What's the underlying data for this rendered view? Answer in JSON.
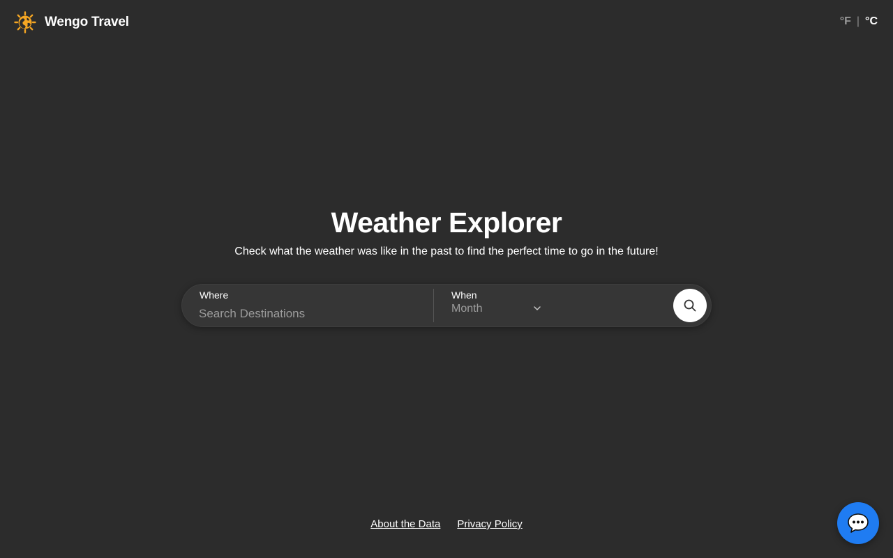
{
  "header": {
    "logo_icon": "sun-globe-logo-icon",
    "brand_name": "Wengo Travel",
    "units": {
      "fahrenheit_label": "°F",
      "separator": "|",
      "celsius_label": "°C",
      "selected": "°C"
    }
  },
  "hero": {
    "title": "Weather Explorer",
    "subtitle": "Check what the weather was like in the past to find the perfect time to go in the future!"
  },
  "search": {
    "where_label": "Where",
    "where_placeholder": "Search Destinations",
    "where_value": "",
    "when_label": "When",
    "when_value": "Month",
    "when_icon": "chevron-down-icon",
    "search_icon": "search-icon"
  },
  "footer": {
    "links": [
      {
        "label": "About the Data"
      },
      {
        "label": "Privacy Policy"
      }
    ]
  },
  "chat": {
    "icon": "chat-bubble-icon"
  },
  "colors": {
    "background": "#2c2c2c",
    "search_bar": "#363636",
    "accent_orange": "#f5a623",
    "chat_blue": "#1f7cf2",
    "muted_text": "#9c9c9c"
  }
}
